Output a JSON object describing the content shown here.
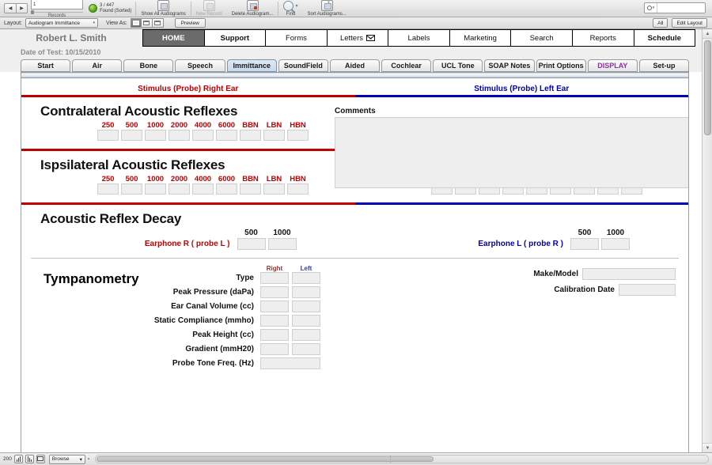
{
  "toolbar": {
    "prev_icon": "◀",
    "next_icon": "▶",
    "record_number": "1",
    "records_caption": "Records",
    "found_count": "3 / 447",
    "found_status": "Found (Sorted)",
    "show_all_label": "Show All Audiograms",
    "new_record_label": "New Record",
    "delete_label": "Delete Audiogram...",
    "find_label": "Find",
    "sort_label": "Sort Audiograms...",
    "search_placeholder": "",
    "search_value": ""
  },
  "layoutbar": {
    "layout_label": "Layout:",
    "layout_value": "Audiogram Immittance",
    "view_as_label": "View As:",
    "preview_label": "Preview",
    "all_label": "All",
    "edit_layout_label": "Edit Layout"
  },
  "header": {
    "patient_name": "Robert L. Smith",
    "date_of_test": "Date of Test: 10/15/2010",
    "main_tabs": [
      {
        "label": "HOME",
        "active": true
      },
      {
        "label": "Support",
        "active": false
      },
      {
        "label": "Forms",
        "active": false
      },
      {
        "label": "Letters",
        "active": false
      },
      {
        "label": "Labels",
        "active": false
      },
      {
        "label": "Marketing",
        "active": false
      },
      {
        "label": "Search",
        "active": false
      },
      {
        "label": "Reports",
        "active": false
      },
      {
        "label": "Schedule",
        "active": false
      }
    ],
    "sub_tabs": [
      {
        "label": "Start"
      },
      {
        "label": "Air"
      },
      {
        "label": "Bone"
      },
      {
        "label": "Speech"
      },
      {
        "label": "Immittance"
      },
      {
        "label": "SoundField"
      },
      {
        "label": "Aided"
      },
      {
        "label": "Cochlear"
      },
      {
        "label": "UCL Tone"
      },
      {
        "label": "SOAP Notes"
      },
      {
        "label": "Print Options"
      },
      {
        "label": "DISPLAY"
      },
      {
        "label": "Set-up"
      }
    ]
  },
  "content": {
    "stimulus_right": "Stimulus (Probe) Right Ear",
    "stimulus_left": "Stimulus (Probe) Left Ear",
    "contralateral_title": "Contralateral Acoustic Reflexes",
    "ipsilateral_title": "Ispsilateral Acoustic Reflexes",
    "decay_title": "Acoustic Reflex Decay",
    "frequencies": [
      "250",
      "500",
      "1000",
      "2000",
      "4000",
      "6000",
      "BBN",
      "LBN",
      "HBN"
    ],
    "reflex_values_right": [
      "",
      "",
      "",
      "",
      "",
      "",
      "",
      "",
      ""
    ],
    "reflex_values_left": [
      "",
      "",
      "",
      "",
      "",
      "",
      "",
      "",
      ""
    ],
    "ipsi_values_right": [
      "",
      "",
      "",
      "",
      "",
      "",
      "",
      "",
      ""
    ],
    "ipsi_values_left": [
      "",
      "",
      "",
      "",
      "",
      "",
      "",
      "",
      ""
    ],
    "decay_freqs": [
      "500",
      "1000"
    ],
    "decay_label_right": "Earphone R  ( probe L )",
    "decay_label_left": "Earphone L  ( probe R )",
    "decay_values_right": [
      "",
      ""
    ],
    "decay_values_left": [
      "",
      ""
    ],
    "tympanometry": {
      "title": "Tympanometry",
      "col_right": "Right",
      "col_left": "Left",
      "rows": [
        {
          "label": "Type",
          "right": "",
          "left": "",
          "span": false
        },
        {
          "label": "Peak Pressure (daPa)",
          "right": "",
          "left": "",
          "span": false
        },
        {
          "label": "Ear Canal Volume (cc)",
          "right": "",
          "left": "",
          "span": false
        },
        {
          "label": "Static Compliance (mmho)",
          "right": "",
          "left": "",
          "span": false
        },
        {
          "label": "Peak Height (cc)",
          "right": "",
          "left": "",
          "span": false
        },
        {
          "label": "Gradient (mmH20)",
          "right": "",
          "left": "",
          "span": false
        },
        {
          "label": "Probe Tone Freq. (Hz)",
          "right": "",
          "left": "",
          "span": true
        }
      ]
    },
    "make_model_label": "Make/Model",
    "make_model_value": "",
    "calibration_label": "Calibration Date",
    "calibration_value": "",
    "comments_label": "Comments",
    "comments_value": ""
  },
  "statusbar": {
    "zoom_level": "200",
    "mode": "Browse"
  },
  "colors": {
    "right_ear": "#c00000",
    "left_ear": "#0000b4",
    "display_tab": "#8e2fa8",
    "active_tab_bg": "#6b6b6b"
  }
}
